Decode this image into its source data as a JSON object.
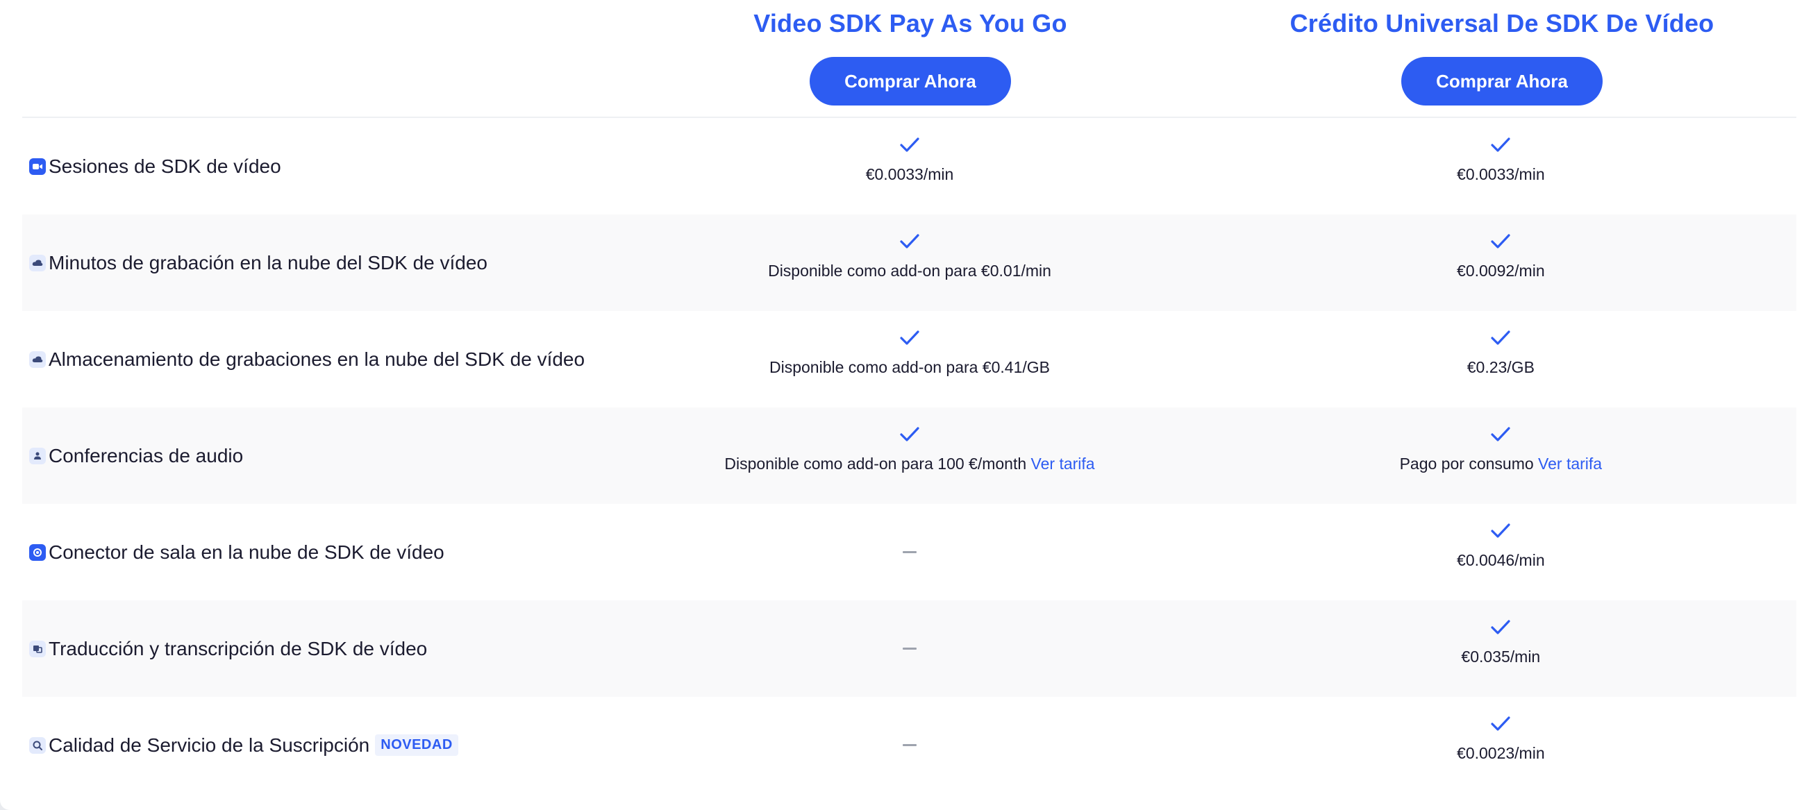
{
  "plans": [
    {
      "title": "Video SDK Pay As You Go",
      "button": "Comprar Ahora"
    },
    {
      "title": "Crédito Universal De SDK De Vídeo",
      "button": "Comprar Ahora"
    }
  ],
  "rows": [
    {
      "feature": "Sesiones de SDK de vídeo",
      "icon": "video-camera-icon",
      "plan1": {
        "text": "€0.0033/min"
      },
      "plan2": {
        "text": "€0.0033/min"
      }
    },
    {
      "feature": "Minutos de grabación en la nube del SDK de vídeo",
      "icon": "cloud-recording-icon",
      "plan1": {
        "text": "Disponible como add-on para €0.01/min"
      },
      "plan2": {
        "text": "€0.0092/min"
      }
    },
    {
      "feature": "Almacenamiento de grabaciones en la nube del SDK de vídeo",
      "icon": "cloud-storage-icon",
      "plan1": {
        "text": "Disponible como add-on para €0.41/GB"
      },
      "plan2": {
        "text": "€0.23/GB"
      }
    },
    {
      "feature": "Conferencias de audio",
      "icon": "audio-conference-icon",
      "plan1": {
        "text": "Disponible como add-on para 100 €/month",
        "link": "Ver tarifa"
      },
      "plan2": {
        "text": "Pago por consumo",
        "link": "Ver tarifa"
      }
    },
    {
      "feature": "Conector de sala en la nube de SDK de vídeo",
      "icon": "room-connector-icon",
      "plan2": {
        "text": "€0.0046/min"
      }
    },
    {
      "feature": "Traducción y transcripción de SDK de vídeo",
      "icon": "translation-icon",
      "plan2": {
        "text": "€0.035/min"
      }
    },
    {
      "feature": "Calidad de Servicio de la Suscripción",
      "badge": "NOVEDAD",
      "icon": "quality-service-icon",
      "plan2": {
        "text": "€0.0023/min"
      }
    }
  ],
  "colors": {
    "accent": "#2d5cf2",
    "row_alt": "#f9f9fa",
    "dash": "#9ea3ae"
  }
}
